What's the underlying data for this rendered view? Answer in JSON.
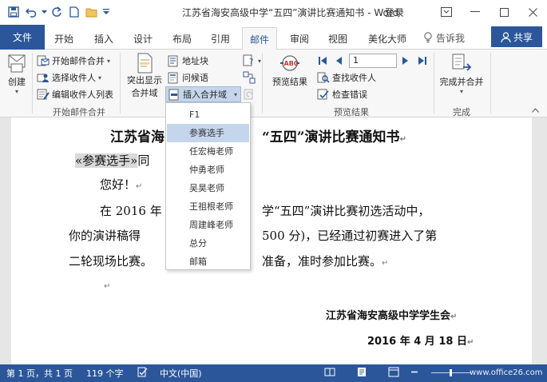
{
  "titlebar": {
    "title": "江苏省海安高级中学“五四”演讲比赛通知书 - Word",
    "login": "登录"
  },
  "tabs": {
    "file": "文件",
    "items": [
      "开始",
      "插入",
      "设计",
      "布局",
      "引用",
      "邮件",
      "审阅",
      "视图",
      "美化大师"
    ],
    "active": "邮件",
    "tell_me": "告诉我",
    "share": "共享"
  },
  "ribbon": {
    "create": {
      "label": "创建"
    },
    "start_mail_merge": {
      "start": "开始邮件合并",
      "select_recipients": "选择收件人",
      "edit_recipients": "编辑收件人列表",
      "group_label": "开始邮件合并"
    },
    "write_insert": {
      "highlight_fields_line1": "突出显示",
      "highlight_fields_line2": "合并域",
      "address_block": "地址块",
      "greeting_line": "问候语",
      "insert_merge_field": "插入合并域"
    },
    "preview": {
      "preview_results": "预览结果",
      "record_number": "1",
      "find_recipient": "查找收件人",
      "check_errors": "检查错误",
      "group_label": "预览结果"
    },
    "finish": {
      "finish_merge": "完成并合并",
      "group_label": "完成"
    }
  },
  "dropdown": {
    "items": [
      "F1",
      "参赛选手",
      "任宏梅老师",
      "仲勇老师",
      "吴昊老师",
      "王祖根老师",
      "周建峰老师",
      "总分",
      "邮箱"
    ],
    "highlighted_index": 1
  },
  "document": {
    "title_left": "江苏省海",
    "title_right": "“五四”演讲比赛通知书",
    "salutation_field": "«参赛选手»",
    "salutation_after": "同",
    "greeting": "您好！",
    "para1_left": "在 2016 年",
    "para1_right": "学“五四”演讲比赛初选活动中，",
    "para2_left": "你的演讲稿得",
    "para2_right": "500 分)，已经通过初赛进入了第",
    "para3_left": "二轮现场比赛。",
    "para3_right": "准备，准时参加比赛。",
    "signature": "江苏省海安高级中学学生会",
    "date": "2016 年 4 月 18 日",
    "pilcrow": "↵"
  },
  "statusbar": {
    "page": "第 1 页，共 1 页",
    "words": "119 个字",
    "language": "中文(中国)",
    "watermark": "www.office26.com"
  },
  "colors": {
    "accent": "#2b579a",
    "ribbon_bg": "#f7f7f7",
    "highlight": "#c5d6ec"
  }
}
